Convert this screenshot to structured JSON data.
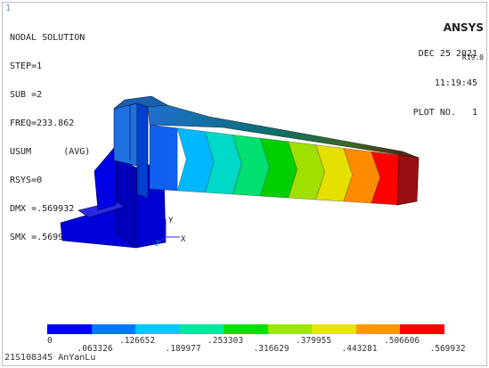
{
  "window": {
    "number": "1"
  },
  "header": {
    "title": "NODAL SOLUTION",
    "step": "STEP=1",
    "sub": "SUB =2",
    "freq": "FREQ=233.862",
    "usum": "USUM      (AVG)",
    "rsys": "RSYS=0",
    "dmx": "DMX =.569932",
    "smx": "SMX =.569932"
  },
  "brand": {
    "name": "ANSYS",
    "version": "R19.0"
  },
  "datetime": {
    "date": "DEC 25 2021",
    "time": "11:19:45",
    "plot": "PLOT NO.   1"
  },
  "triad": {
    "y": "Y",
    "z": "Z",
    "x": "X"
  },
  "legend": {
    "colors": [
      "#0000ff",
      "#0077ff",
      "#00c8ff",
      "#00e6a0",
      "#00e000",
      "#9ee600",
      "#e6e600",
      "#ff9600",
      "#ff0000"
    ],
    "top_labels": [
      "0",
      ".126652",
      ".253303",
      ".379955",
      ".506606"
    ],
    "bottom_labels": [
      ".063326",
      ".189977",
      ".316629",
      ".443281",
      ".569932"
    ]
  },
  "footer": {
    "label": "21S108345 AnYanLu"
  }
}
